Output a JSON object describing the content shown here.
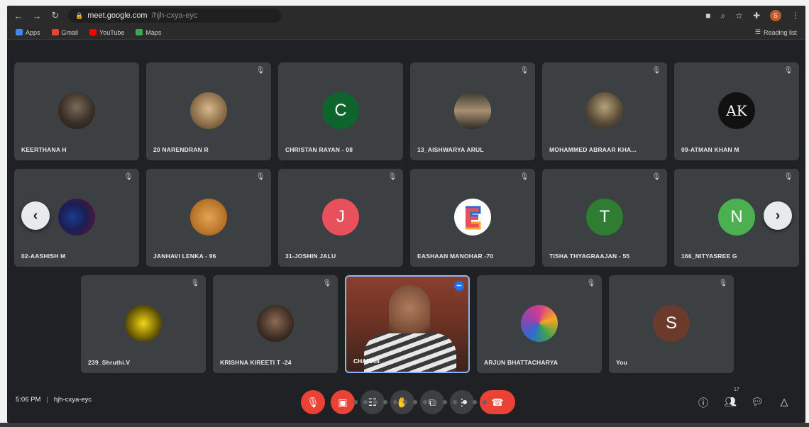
{
  "browser": {
    "url": "meet.google.com",
    "url_suffix": "/hjh-cxya-eyc",
    "reading_list": "Reading list",
    "profile_initial": "S"
  },
  "bookmarks": [
    {
      "label": "Apps",
      "color": "#4285f4"
    },
    {
      "label": "Gmail",
      "color": "#ea4335"
    },
    {
      "label": "YouTube",
      "color": "#ff0000"
    },
    {
      "label": "Maps",
      "color": "#34a853"
    }
  ],
  "participants": [
    {
      "name": "KEERTHANA H",
      "initial": ""
    },
    {
      "name": "20 NARENDRAN R",
      "initial": ""
    },
    {
      "name": "CHRISTAN RAYAN - 08",
      "initial": "C",
      "color": "#0d652d"
    },
    {
      "name": "13_AISHWARYA ARUL",
      "initial": ""
    },
    {
      "name": "MOHAMMED ABRAAR KHA...",
      "initial": ""
    },
    {
      "name": "09-ATMAN KHAN M",
      "initial": "AK",
      "color": "#111111"
    },
    {
      "name": "02-AASHISH M",
      "initial": ""
    },
    {
      "name": "JANHAVI LENKA - 96",
      "initial": ""
    },
    {
      "name": "31-JOSHIN JALU",
      "initial": "J",
      "color": "#e8505b"
    },
    {
      "name": "EASHAAN MANOHAR -70",
      "initial": ""
    },
    {
      "name": "TISHA THYAGRAAJAN - 55",
      "initial": "T",
      "color": "#2e7d32"
    },
    {
      "name": "166_NITYASREE G",
      "initial": "N",
      "color": "#4caf50"
    },
    {
      "name": "239_Shruthi.V",
      "initial": ""
    },
    {
      "name": "KRISHNA KIREETI T -24",
      "initial": ""
    },
    {
      "name": "ARJUN BHATTACHARYA",
      "initial": ""
    },
    {
      "name": "You",
      "initial": "S",
      "color": "#6b3a2a"
    }
  ],
  "self_tile": {
    "name": "CHARAN"
  },
  "meeting": {
    "time": "5:06 PM",
    "code": "hjh-cxya-eyc",
    "participant_count": "17"
  },
  "colors": {
    "accent": "#8ab4f8",
    "end_call": "#ea4335",
    "tile_bg": "#3c4043",
    "background": "#202124"
  }
}
